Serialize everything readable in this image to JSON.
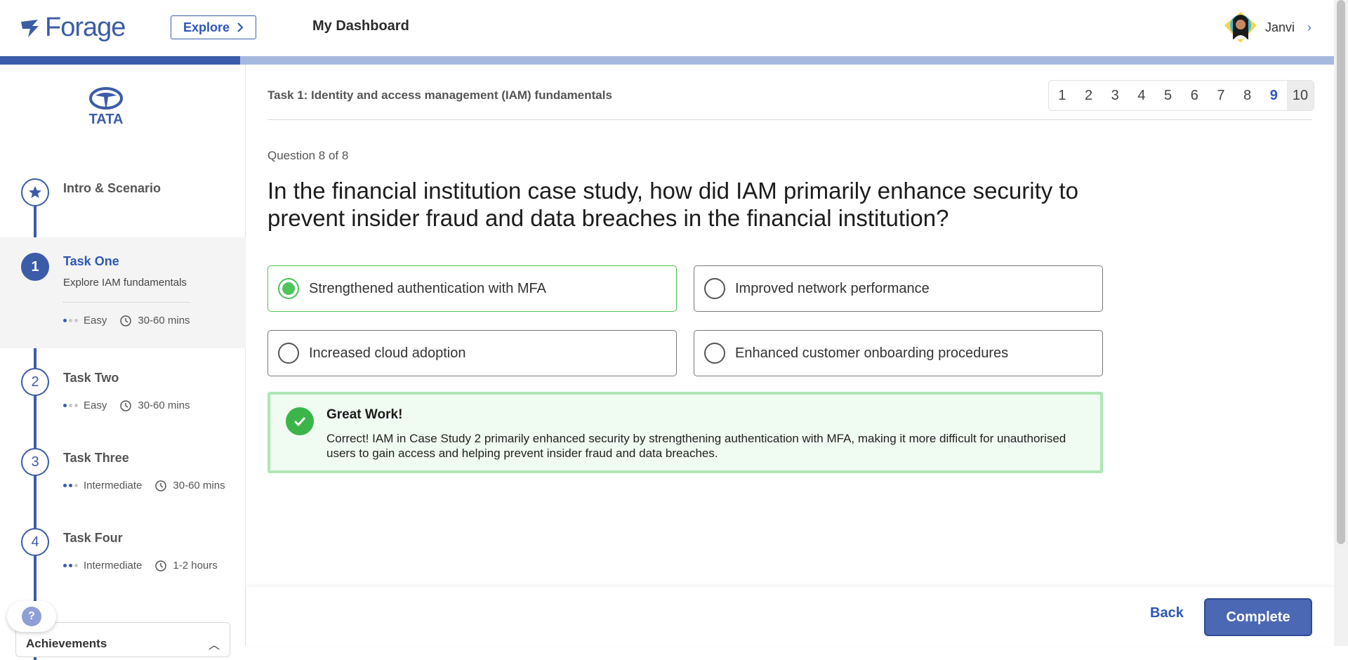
{
  "header": {
    "logo_text": "Forage",
    "explore_label": "Explore",
    "dashboard_label": "My Dashboard",
    "user_name": "Janvi"
  },
  "progress": {
    "fraction": 0.18
  },
  "sidebar": {
    "company_logo_text": "TATA",
    "steps": [
      {
        "title": "Intro & Scenario",
        "icon": "star-icon"
      },
      {
        "number": "1",
        "title": "Task One",
        "subtitle": "Explore IAM fundamentals",
        "level": "Easy",
        "level_dots": 1,
        "duration": "30-60 mins"
      },
      {
        "number": "2",
        "title": "Task Two",
        "level": "Easy",
        "level_dots": 1,
        "duration": "30-60 mins"
      },
      {
        "number": "3",
        "title": "Task Three",
        "level": "Intermediate",
        "level_dots": 2,
        "duration": "30-60 mins"
      },
      {
        "number": "4",
        "title": "Task Four",
        "level": "Intermediate",
        "level_dots": 2,
        "duration": "1-2 hours"
      }
    ],
    "help_label": "?",
    "achievements_label": "Achievements"
  },
  "main": {
    "task_title": "Task 1: Identity and access management (IAM) fundamentals",
    "pages": [
      "1",
      "2",
      "3",
      "4",
      "5",
      "6",
      "7",
      "8",
      "9",
      "10"
    ],
    "current_page": "9",
    "question_counter": "Question 8 of 8",
    "question": "In the financial institution case study, how did IAM primarily enhance security to prevent insider fraud and data breaches in the financial institution?",
    "options": [
      {
        "label": "Strengthened authentication with MFA",
        "selected": true
      },
      {
        "label": "Improved network performance",
        "selected": false
      },
      {
        "label": "Increased cloud adoption",
        "selected": false
      },
      {
        "label": "Enhanced customer onboarding procedures",
        "selected": false
      }
    ],
    "feedback": {
      "title": "Great Work!",
      "text": "Correct! IAM in Case Study 2 primarily enhanced security by strengthening authentication with MFA, making it more difficult for unauthorised users to gain access and helping prevent insider fraud and data breaches."
    }
  },
  "footer": {
    "back_label": "Back",
    "complete_label": "Complete"
  },
  "colors": {
    "brand": "#3b5ca8",
    "success": "#4cc45a",
    "success_bg": "#f0fbf1"
  }
}
